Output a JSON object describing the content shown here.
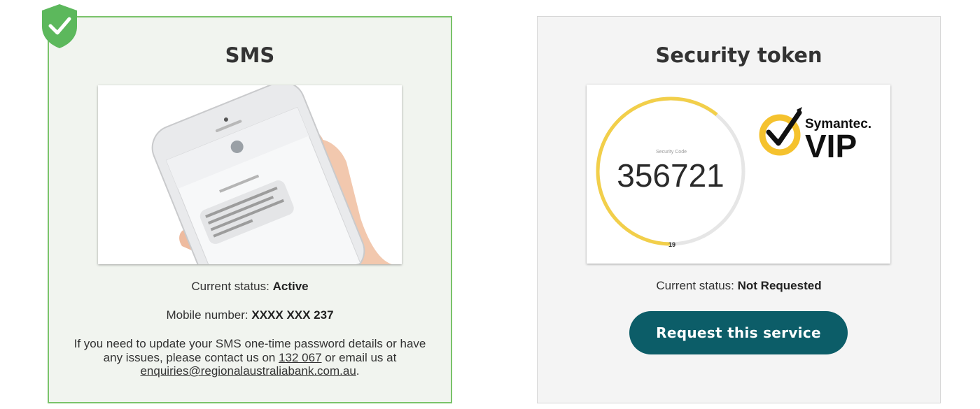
{
  "sms": {
    "title": "SMS",
    "status_label": "Current status:",
    "status_value": "Active",
    "mobile_label": "Mobile number:",
    "mobile_value": "XXXX XXX 237",
    "help_prefix": "If you need to update your SMS one-time password details or have any issues, please contact us on",
    "phone": "132 067",
    "help_middle": "or email us at",
    "email": "enquiries@regionalaustraliabank.com.au",
    "help_suffix": ".",
    "badge_icon": "shield-check-icon",
    "image_icon": "phone-in-hand-illustration"
  },
  "token": {
    "title": "Security token",
    "code_label": "Security Code",
    "code": "356721",
    "timer": "19",
    "brand_name": "Symantec.",
    "brand_product": "VIP",
    "status_label": "Current status:",
    "status_value": "Not Requested",
    "button_label": "Request this service"
  },
  "colors": {
    "sms_border": "#7ac36a",
    "sms_background": "#f1f4ef",
    "badge_green": "#5cb85c",
    "button_teal": "#0c5d68",
    "token_ring_yellow": "#f2cf4a",
    "symantec_yellow": "#f5c22e"
  }
}
